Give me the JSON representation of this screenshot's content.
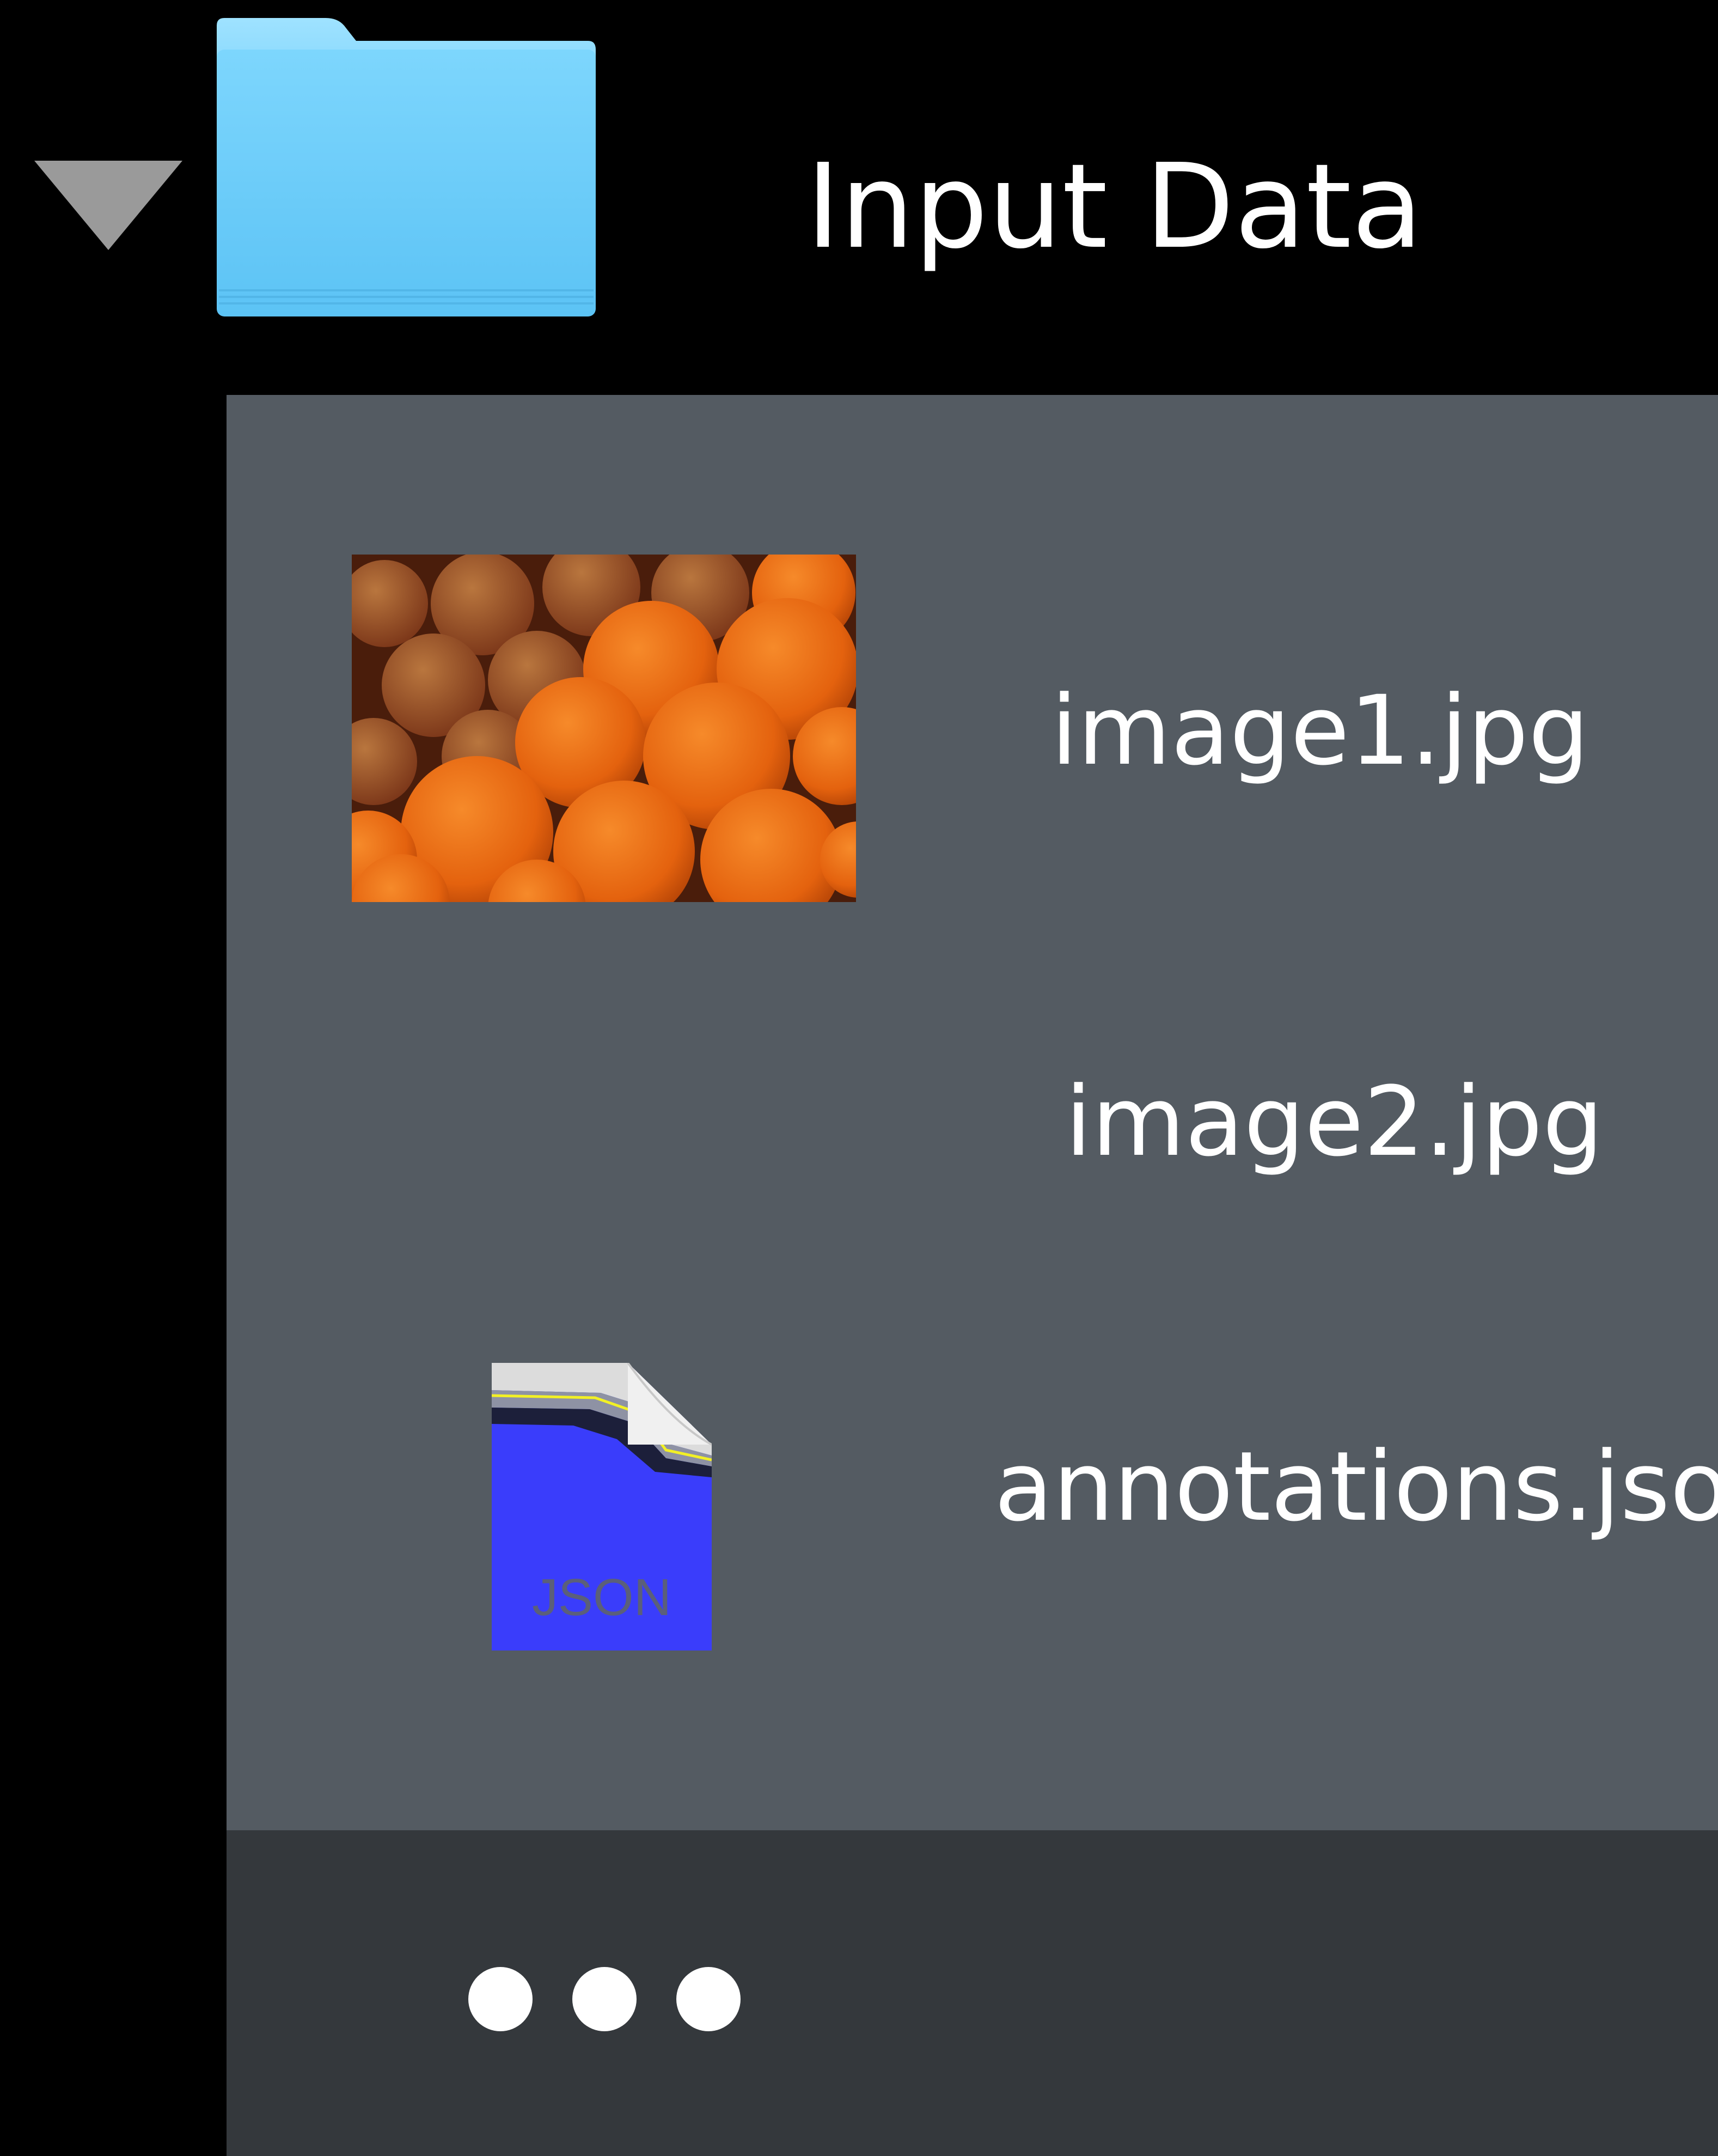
{
  "folder": {
    "name": "Input Data",
    "expanded": true,
    "icon": "folder-icon",
    "disclosure_icon": "disclosure-triangle-down-icon"
  },
  "files": [
    {
      "name": "image1.jpg",
      "icon": "image-thumbnail"
    },
    {
      "name": "image2.jpg",
      "icon": ""
    },
    {
      "name": "annotations.json",
      "icon": "json-file-icon",
      "icon_label": "JSON"
    }
  ],
  "footer": {
    "more_icon": "ellipsis-icon"
  },
  "colors": {
    "background": "#000000",
    "panel": "#545b62",
    "footer": "#34383c",
    "folder_blue": "#6ecbf8",
    "json_blue": "#3a3dfb"
  }
}
